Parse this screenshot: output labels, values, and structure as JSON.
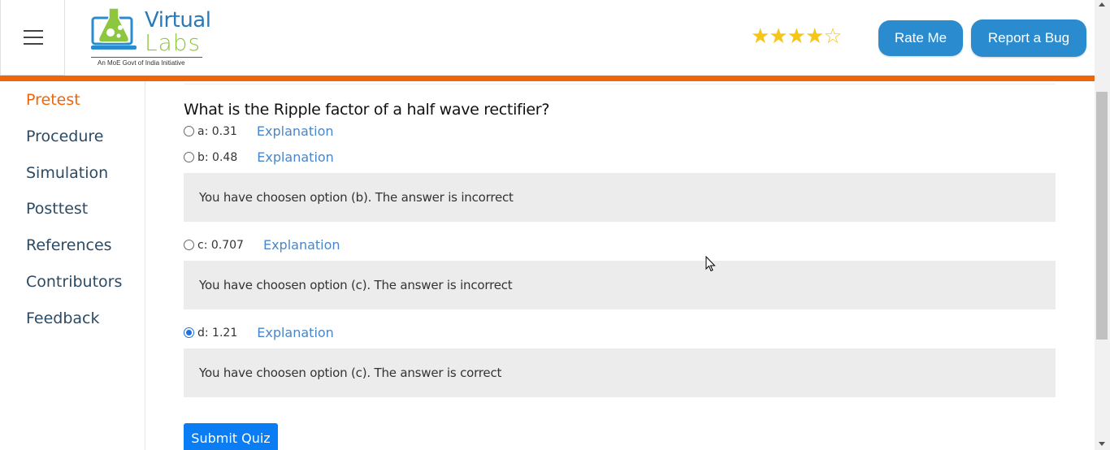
{
  "header": {
    "logo_title_1": "Virtual",
    "logo_title_2": "Labs",
    "logo_tagline": "An MoE Govt of India Initiative",
    "rating_filled": 4,
    "rating_total": 5,
    "rate_label": "Rate Me",
    "bug_label": "Report a Bug",
    "accent_color": "#f0650a",
    "button_color": "#2a8ccf"
  },
  "sidebar": {
    "items": [
      {
        "label": "Pretest",
        "active": true
      },
      {
        "label": "Procedure",
        "active": false
      },
      {
        "label": "Simulation",
        "active": false
      },
      {
        "label": "Posttest",
        "active": false
      },
      {
        "label": "References",
        "active": false
      },
      {
        "label": "Contributors",
        "active": false
      },
      {
        "label": "Feedback",
        "active": false
      }
    ]
  },
  "quiz": {
    "question": "What is the Ripple factor of a half wave rectifier?",
    "options": [
      {
        "label": "a: 0.31",
        "explanation": "Explanation",
        "checked": false
      },
      {
        "label": "b: 0.48",
        "explanation": "Explanation",
        "checked": false,
        "feedback": "You have choosen option (b). The answer is incorrect"
      },
      {
        "label": "c: 0.707",
        "explanation": "Explanation",
        "checked": false,
        "feedback": "You have choosen option (c). The answer is incorrect"
      },
      {
        "label": "d: 1.21",
        "explanation": "Explanation",
        "checked": true,
        "feedback": "You have choosen option (c). The answer is correct"
      }
    ],
    "submit_label": "Submit Quiz"
  }
}
